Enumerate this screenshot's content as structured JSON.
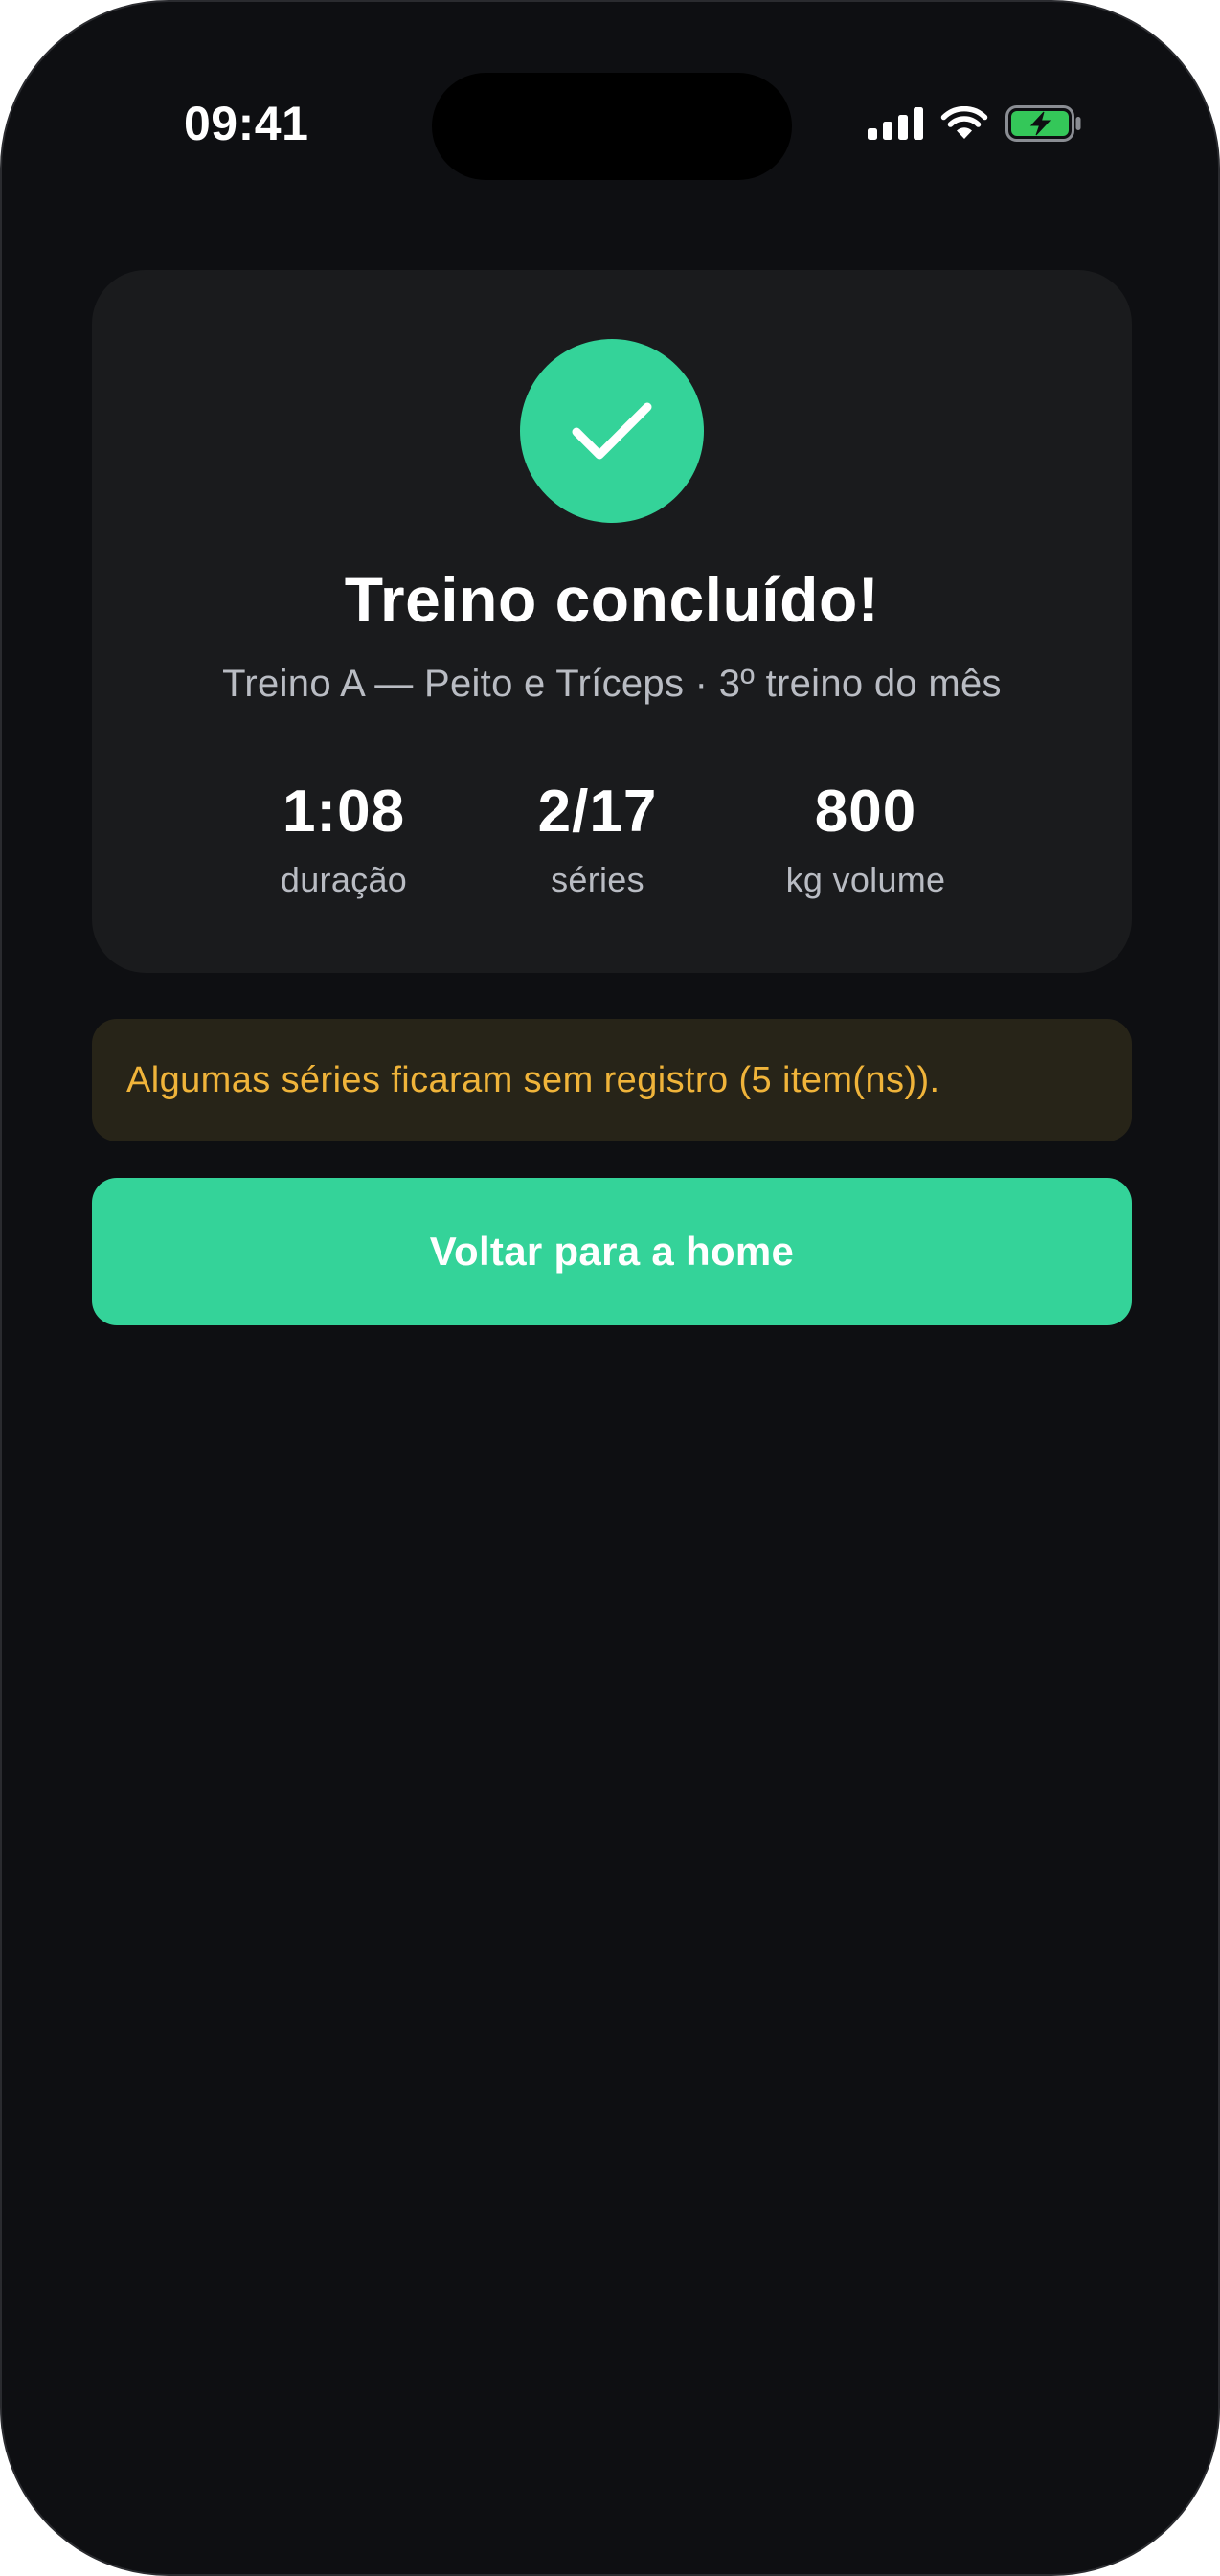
{
  "status_bar": {
    "time": "09:41",
    "icons": [
      "cellular-signal-icon",
      "wifi-icon",
      "battery-charging-icon"
    ]
  },
  "summary": {
    "icon": "checkmark-icon",
    "title": "Treino concluído!",
    "subtitle": "Treino A — Peito e Tríceps · 3º treino do mês",
    "stats": [
      {
        "value": "1:08",
        "label": "duração"
      },
      {
        "value": "2/17",
        "label": "séries"
      },
      {
        "value": "800",
        "label": "kg volume"
      }
    ]
  },
  "warning": {
    "text": "Algumas séries ficaram sem registro (5 item(ns))."
  },
  "actions": {
    "home_label": "Voltar para a home"
  },
  "colors": {
    "accent": "#34d399",
    "background": "#0e0f12",
    "card": "#1a1b1d",
    "warning_bg": "#272418",
    "warning_text": "#f0b43a",
    "battery_fill": "#34c759"
  }
}
